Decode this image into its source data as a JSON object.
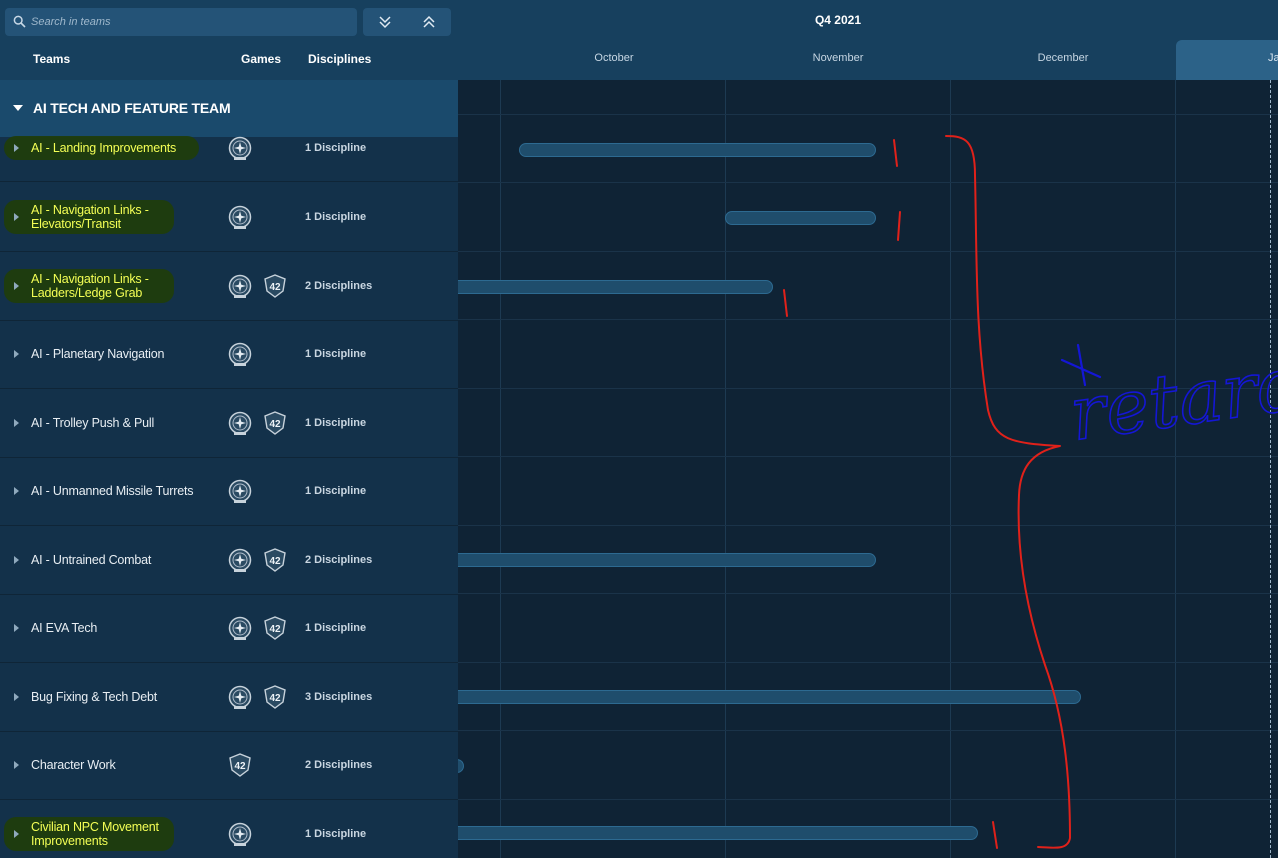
{
  "search": {
    "placeholder": "Search in teams"
  },
  "columns": {
    "teams": "Teams",
    "games": "Games",
    "disciplines": "Disciplines"
  },
  "timeline": {
    "quarter": "Q4 2021",
    "months": [
      "October",
      "November",
      "December",
      "Ja"
    ]
  },
  "group": {
    "title": "AI TECH AND FEATURE TEAM"
  },
  "rows": [
    {
      "name": "AI - Landing Improvements",
      "disciplines": "1 Discipline",
      "games": [
        "star-citizen"
      ],
      "highlighted": true
    },
    {
      "name": "AI - Navigation Links - Elevators/Transit",
      "disciplines": "1 Discipline",
      "games": [
        "star-citizen"
      ],
      "highlighted": true
    },
    {
      "name": "AI - Navigation Links - Ladders/Ledge Grab",
      "disciplines": "2 Disciplines",
      "games": [
        "star-citizen",
        "squadron-42"
      ],
      "highlighted": true
    },
    {
      "name": "AI - Planetary Navigation",
      "disciplines": "1 Discipline",
      "games": [
        "star-citizen"
      ],
      "highlighted": false
    },
    {
      "name": "AI - Trolley Push & Pull",
      "disciplines": "1 Discipline",
      "games": [
        "star-citizen",
        "squadron-42"
      ],
      "highlighted": false
    },
    {
      "name": "AI - Unmanned Missile Turrets",
      "disciplines": "1 Discipline",
      "games": [
        "star-citizen"
      ],
      "highlighted": false
    },
    {
      "name": "AI - Untrained Combat",
      "disciplines": "2 Disciplines",
      "games": [
        "star-citizen",
        "squadron-42"
      ],
      "highlighted": false
    },
    {
      "name": "AI EVA Tech",
      "disciplines": "1 Discipline",
      "games": [
        "star-citizen",
        "squadron-42"
      ],
      "highlighted": false
    },
    {
      "name": "Bug Fixing & Tech Debt",
      "disciplines": "3 Disciplines",
      "games": [
        "star-citizen",
        "squadron-42"
      ],
      "highlighted": false
    },
    {
      "name": "Character Work",
      "disciplines": "2 Disciplines",
      "games": [
        "squadron-42"
      ],
      "highlighted": false
    },
    {
      "name": "Civilian NPC Movement Improvements",
      "disciplines": "1 Discipline",
      "games": [
        "star-citizen"
      ],
      "highlighted": true
    }
  ],
  "annotation": {
    "text": "retard"
  },
  "colors": {
    "accent": "#17405e",
    "highlight_text": "#f4ff55",
    "marker_red": "#e0211a",
    "marker_blue": "#1416d6"
  }
}
